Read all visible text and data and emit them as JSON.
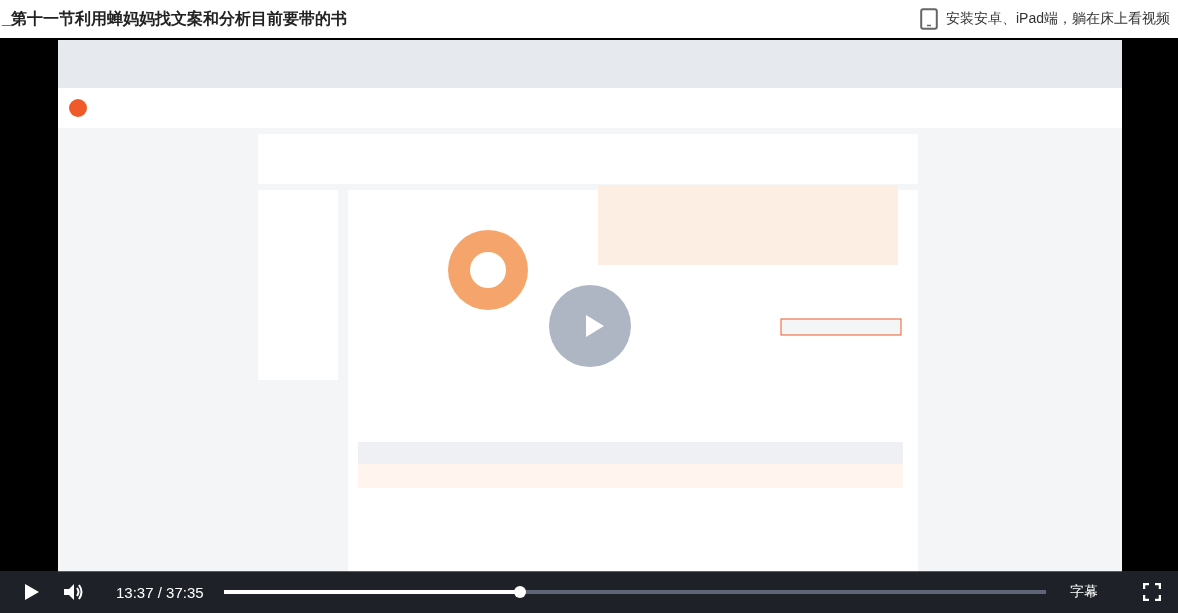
{
  "title": "_第十一节利用蝉妈妈找文案和分析目前要带的书",
  "app_promo": {
    "label": "安装安卓、iPad端，躺在床上看视频"
  },
  "player": {
    "playing": false,
    "time": "13:37 / 37:35",
    "progress": {
      "level": 0.36
    },
    "subtitles": "字幕"
  }
}
